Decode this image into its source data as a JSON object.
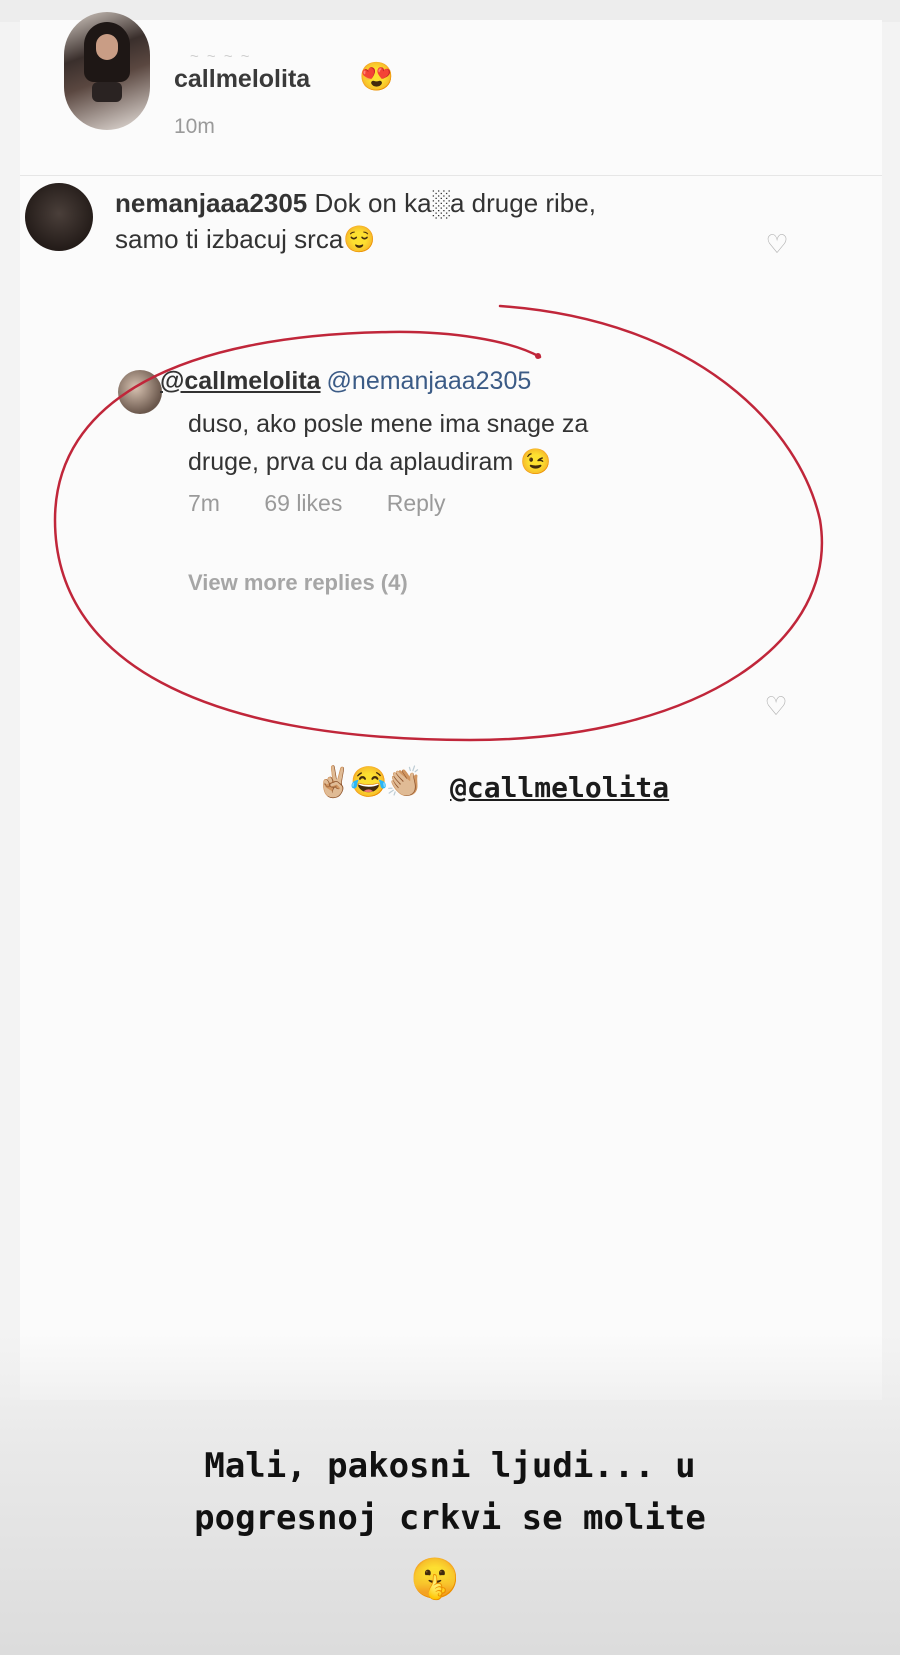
{
  "post": {
    "username": "callmelolita",
    "emoji": "😍",
    "time": "10m",
    "faded_handle": "~ ~ ~ ~"
  },
  "comment": {
    "username": "nemanjaaa2305",
    "text_line1": "Dok on ka░a druge ribe,",
    "text_line2": "samo ti izbacuj srca",
    "emoji": "😌"
  },
  "reply": {
    "username": "@callmelolita",
    "mention": "@nemanjaaa2305",
    "text_line1": "duso, ako posle mene ima snage za",
    "text_line2": "druge, prva cu da aplaudiram",
    "emoji": "😉",
    "time": "7m",
    "likes": "69 likes",
    "reply_label": "Reply",
    "view_more": "View more replies (4)"
  },
  "story_overlay": {
    "emojis": "✌🏼😂👏🏼",
    "mention": "@callmelolita",
    "caption_line1": "Mali, pakosni ljudi... u",
    "caption_line2": "pogresnoj crkvi se molite",
    "caption_emoji": "🤫"
  },
  "colors": {
    "highlight_circle": "#c0263a",
    "mention_blue": "#3b5b86",
    "muted_gray": "#9a9a9a"
  },
  "icons": {
    "comment_like": "heart-outline-icon",
    "reply_like": "heart-outline-icon"
  }
}
